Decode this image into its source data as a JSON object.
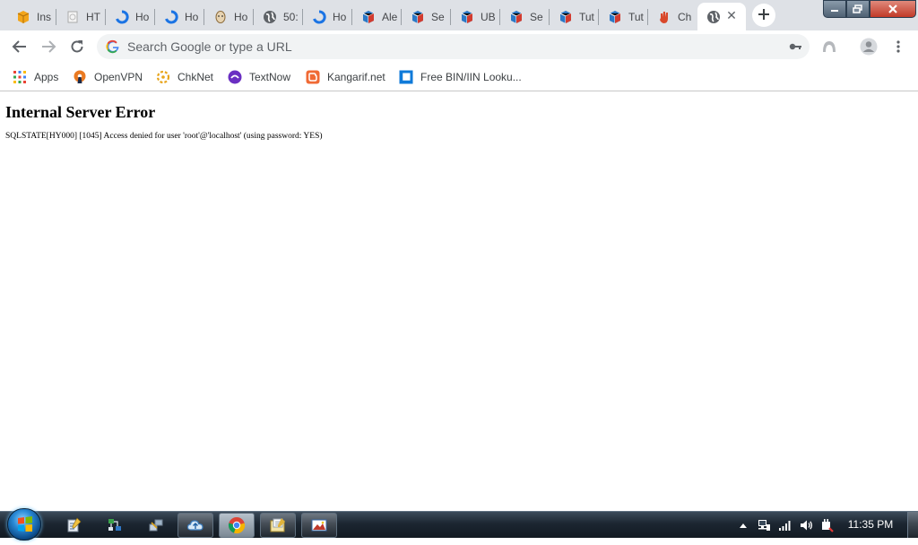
{
  "tabs": [
    {
      "title": "Ins",
      "icon": "package-icon"
    },
    {
      "title": "HT",
      "icon": "page-icon"
    },
    {
      "title": "Ho",
      "icon": "blue-swirl-icon"
    },
    {
      "title": "Ho",
      "icon": "blue-swirl-icon"
    },
    {
      "title": "Ho",
      "icon": "face-icon"
    },
    {
      "title": "50:",
      "icon": "globe-icon"
    },
    {
      "title": "Ho",
      "icon": "blue-swirl-icon"
    },
    {
      "title": "Ale",
      "icon": "cube-icon"
    },
    {
      "title": "Se",
      "icon": "cube-icon"
    },
    {
      "title": "UB",
      "icon": "cube-icon"
    },
    {
      "title": "Se",
      "icon": "cube-icon"
    },
    {
      "title": "Tut",
      "icon": "cube-icon"
    },
    {
      "title": "Tut",
      "icon": "cube-icon"
    },
    {
      "title": "Ch",
      "icon": "hand-icon"
    }
  ],
  "active_tab": {
    "icon": "globe-icon",
    "close": "✕"
  },
  "omnibox": {
    "placeholder": "Search Google or type a URL"
  },
  "bookmarks": [
    {
      "label": "Apps",
      "icon": "apps-grid-icon"
    },
    {
      "label": "OpenVPN",
      "icon": "openvpn-icon"
    },
    {
      "label": "ChkNet",
      "icon": "chknet-icon"
    },
    {
      "label": "TextNow",
      "icon": "textnow-icon"
    },
    {
      "label": "Kangarif.net",
      "icon": "blogger-icon"
    },
    {
      "label": "Free BIN/IIN Looku...",
      "icon": "bin-lookup-icon"
    }
  ],
  "page": {
    "heading": "Internal Server Error",
    "message": "SQLSTATE[HY000] [1045] Access denied for user 'root'@'localhost' (using password: YES)"
  },
  "taskbar": {
    "clock": "11:35 PM",
    "buttons": [
      "notepad-icon",
      "network-map-icon",
      "network-tool-icon",
      "cloud-icon",
      "chrome-icon",
      "folder-note-icon",
      "image-viewer-icon"
    ]
  },
  "colors": {
    "tabstrip": "#dee1e6",
    "omnibox": "#f1f3f4",
    "accent_blue": "#1a73e8"
  }
}
